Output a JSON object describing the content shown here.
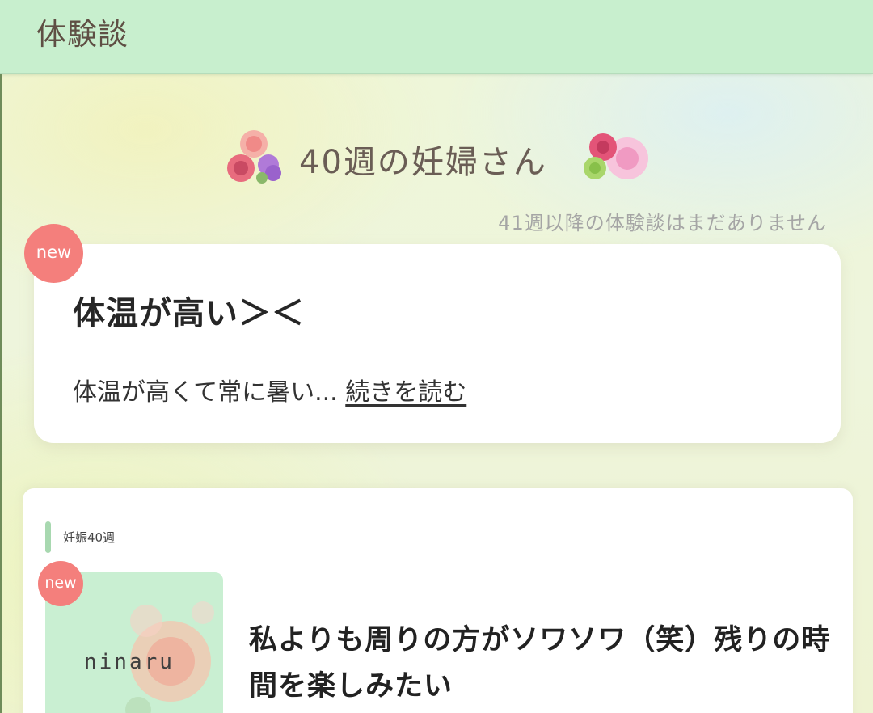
{
  "header": {
    "title": "体験談"
  },
  "week": {
    "title": "40週の妊婦さん",
    "notice": "41週以降の体験談はまだありません"
  },
  "featured": {
    "badge": "new",
    "title": "体温が高い＞＜",
    "excerpt": "体温が高くて常に暑い...",
    "read_more": "続きを読む"
  },
  "article": {
    "category": "妊娠40週",
    "badge": "new",
    "thumbnail_logo": "ninaru",
    "title": "私よりも周りの方がソワソワ（笑）残りの時間を楽しみたい"
  },
  "colors": {
    "header_bg": "#c8efce",
    "badge": "#f47f7c",
    "category_bar": "#a8d8b0",
    "thumbnail_bg": "#c9efd2"
  },
  "icons": [
    "flower-decoration-icon",
    "flower-decoration-icon"
  ]
}
